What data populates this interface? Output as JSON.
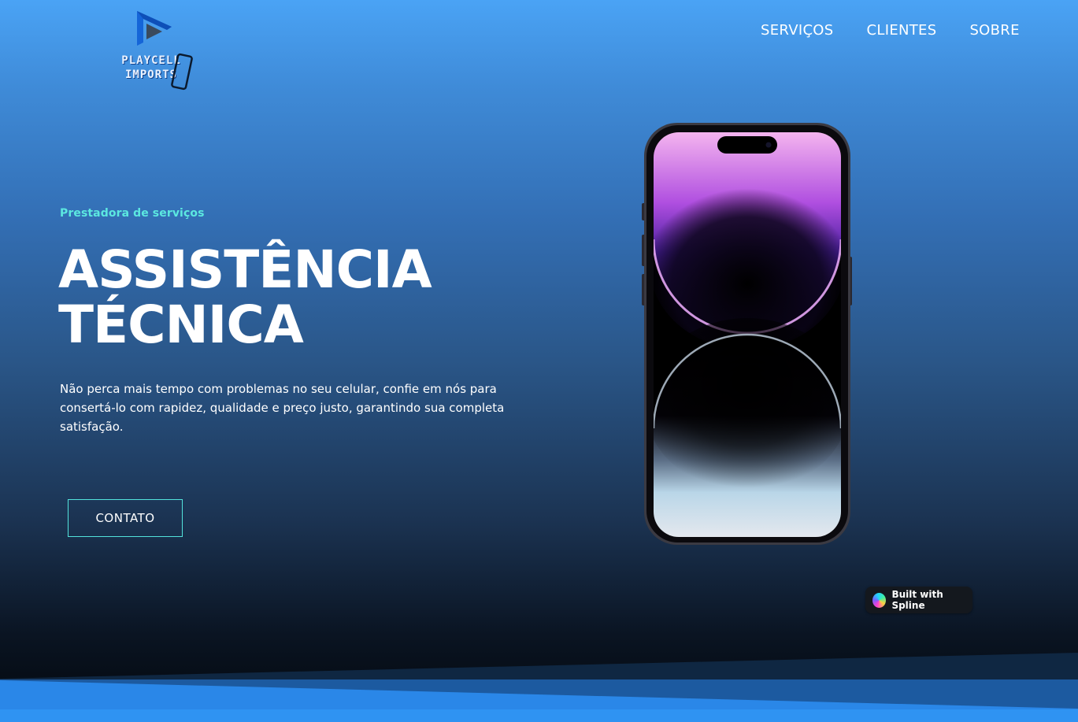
{
  "brand": {
    "line1": "PLAYCELL",
    "line2": "IMPORTS"
  },
  "nav": {
    "items": [
      {
        "label": "SERVIÇOS"
      },
      {
        "label": "CLIENTES"
      },
      {
        "label": "SOBRE"
      }
    ]
  },
  "hero": {
    "eyebrow": "Prestadora de serviços",
    "title_line1": "ASSISTÊNCIA",
    "title_line2": "TÉCNICA",
    "description": "Não perca mais tempo com problemas no seu celular, confie em nós para consertá-lo com rapidez, qualidade e preço justo, garantindo sua completa satisfação.",
    "cta_label": "CONTATO"
  },
  "badge": {
    "label": "Built with Spline"
  },
  "colors": {
    "accent": "#5ce8e0",
    "brand_blue": "#1565d8",
    "background_top": "#4aa3f5",
    "background_bottom": "#03070c"
  },
  "icons": {
    "logo_play": "play-logo-icon",
    "logo_phone": "phone-outline-icon",
    "spline": "spline-logo-icon"
  }
}
